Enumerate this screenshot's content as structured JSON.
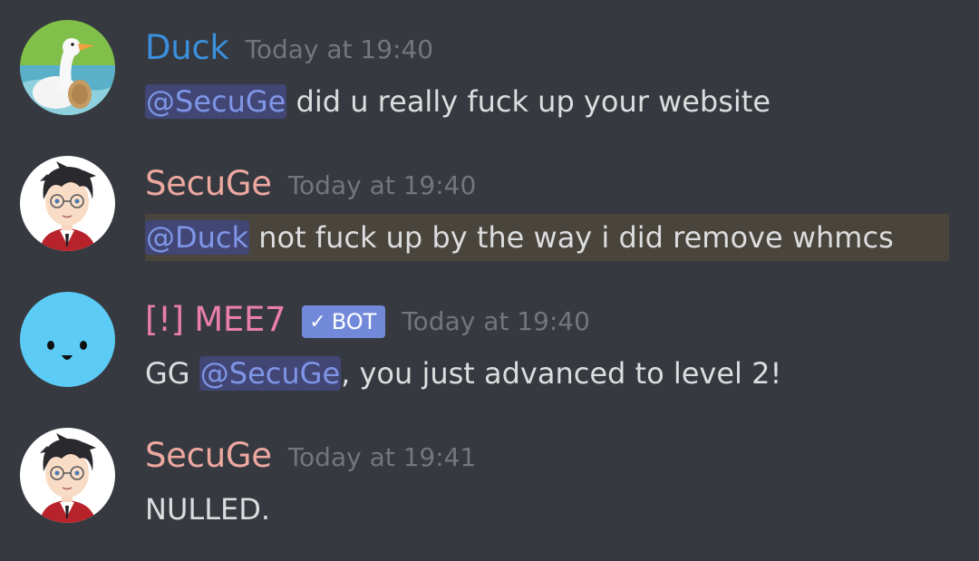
{
  "colors": {
    "background": "#36393f",
    "text": "#dcddde",
    "timestamp": "#72767d",
    "mention_text": "#7f95e6",
    "mention_bg": "#414675",
    "highlight_bg": "#49443c",
    "highlight_mention_bg": "#414675",
    "duck_name": "#3b90dd",
    "secuge_name": "#eda8a0",
    "mee7_name": "#ea7fa9",
    "bot_tag": "#7289da"
  },
  "messages": [
    {
      "author": "Duck",
      "timestamp": "Today at 19:40",
      "avatar_icon": "duck-avatar-icon",
      "mention": "@SecuGe",
      "text_after": " did u really fuck up your website"
    },
    {
      "author": "SecuGe",
      "timestamp": "Today at 19:40",
      "avatar_icon": "boy-avatar-icon",
      "mention": "@Duck",
      "text_after": " not fuck up by the way i did remove whmcs"
    },
    {
      "author": "[!] MEE7",
      "bot_tag": "BOT",
      "bot_check": "✓",
      "timestamp": "Today at 19:40",
      "avatar_icon": "smiley-avatar-icon",
      "text_before": "GG ",
      "mention": "@SecuGe",
      "text_after": ", you just advanced to level 2!"
    },
    {
      "author": "SecuGe",
      "timestamp": "Today at 19:41",
      "avatar_icon": "boy-avatar-icon",
      "text_after": "NULLED."
    }
  ]
}
